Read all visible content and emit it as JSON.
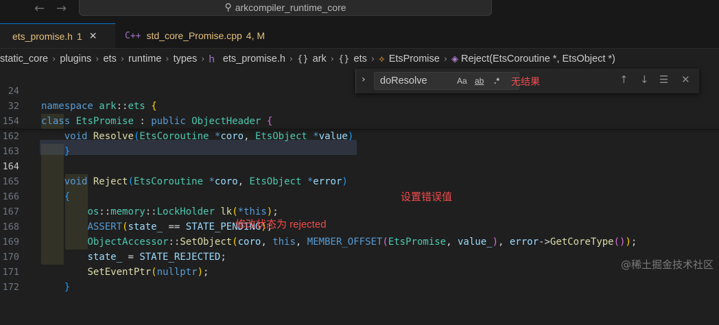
{
  "window": {
    "command_center_text": "arkcompiler_runtime_core"
  },
  "tabs": [
    {
      "label": "ets_promise.h",
      "badge": "1",
      "close": "✕"
    },
    {
      "label": "std_core_Promise.cpp",
      "badge": "4, M",
      "icon": "C++"
    }
  ],
  "breadcrumb": {
    "items": [
      "static_core",
      "plugins",
      "ets",
      "runtime",
      "types",
      "ets_promise.h",
      "ark",
      "ets",
      "EtsPromise",
      "Reject(EtsCoroutine *, EtsObject *)"
    ],
    "namespace_icon": "{}",
    "class_icon": "class-icon",
    "method_icon": "method-cube-icon",
    "file_icon": "h"
  },
  "find": {
    "value": "doResolve",
    "match_case": "Aa",
    "whole_word": "ab",
    "regex": ".*",
    "no_results": "无结果"
  },
  "line_numbers": [
    "24",
    "32",
    "154",
    "162",
    "163",
    "164",
    "165",
    "166",
    "167",
    "168",
    "169",
    "170",
    "171",
    "172"
  ],
  "current_line": "164",
  "annotations": {
    "set_error_value": "设置错误值",
    "change_state": "修改状态为 rejected"
  },
  "watermark": "@稀土掘金技术社区",
  "colors": {
    "keyword": "#569cd6",
    "type": "#4ec9b0",
    "function": "#dcdcaa",
    "variable": "#9cdcfe",
    "annotation": "#f14c4c"
  }
}
